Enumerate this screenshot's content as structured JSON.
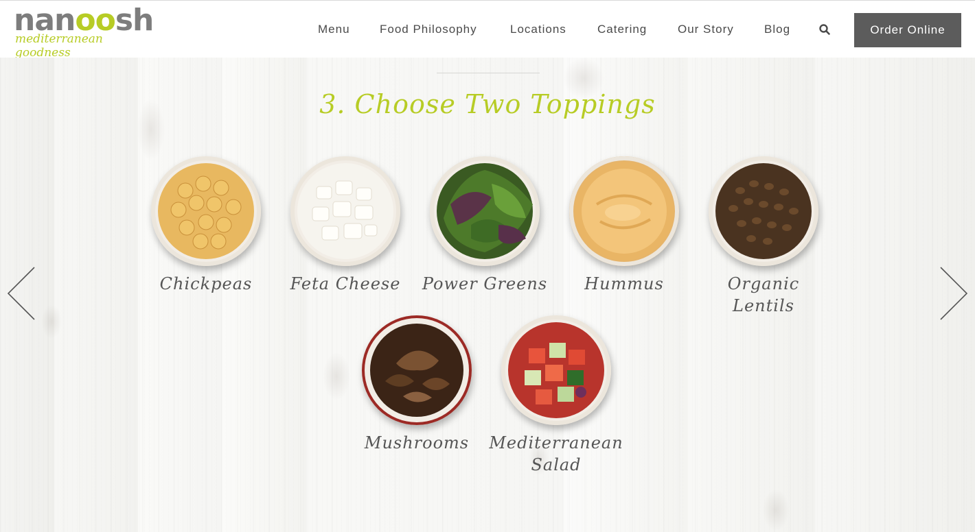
{
  "brand": {
    "logo_word": "nanoosh",
    "tagline": "mediterranean goodness"
  },
  "nav": {
    "items": [
      "Menu",
      "Food Philosophy",
      "Locations",
      "Catering",
      "Our Story",
      "Blog"
    ],
    "order_label": "Order Online"
  },
  "step": {
    "title": "3. Choose Two Toppings"
  },
  "toppings": [
    {
      "label": "Chickpeas"
    },
    {
      "label": "Feta Cheese"
    },
    {
      "label": "Power Greens"
    },
    {
      "label": "Hummus"
    },
    {
      "label": "Organic Lentils"
    },
    {
      "label": "Mushrooms"
    },
    {
      "label": "Mediterranean Salad"
    }
  ],
  "colors": {
    "accent": "#b7cc25",
    "nav_text": "#4a4a4a",
    "button_bg": "#5c5c5c"
  },
  "icons": {
    "search": "search-icon",
    "prev": "chevron-left-icon",
    "next": "chevron-right-icon"
  }
}
